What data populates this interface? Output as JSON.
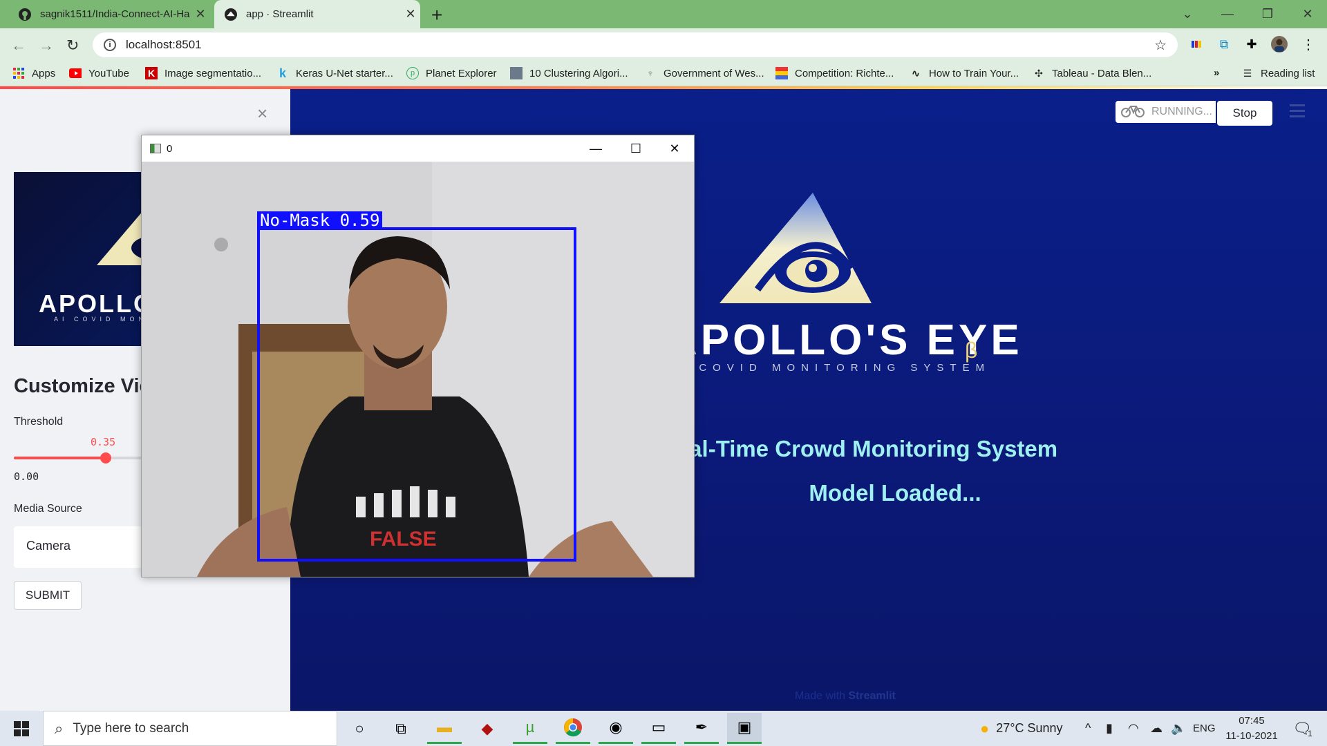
{
  "browser": {
    "tabs": [
      {
        "title": "sagnik1511/India-Connect-AI-Ha",
        "icon": "github-icon",
        "active": false
      },
      {
        "title": "app · Streamlit",
        "icon": "streamlit-icon",
        "active": true
      }
    ],
    "url": "localhost:8501",
    "bookmarks": [
      {
        "label": "Apps",
        "icon": "apps-grid-icon"
      },
      {
        "label": "YouTube",
        "icon": "youtube-icon"
      },
      {
        "label": "Image segmentatio...",
        "icon": "kaggle-k-icon"
      },
      {
        "label": "Keras U-Net starter...",
        "icon": "kaggle-k-icon"
      },
      {
        "label": "Planet Explorer",
        "icon": "planet-icon"
      },
      {
        "label": "10 Clustering Algori...",
        "icon": "page-icon"
      },
      {
        "label": "Government of Wes...",
        "icon": "emblem-icon"
      },
      {
        "label": "Competition: Richte...",
        "icon": "flag-icon"
      },
      {
        "label": "How to Train Your...",
        "icon": "wave-icon"
      },
      {
        "label": "Tableau - Data Blen...",
        "icon": "tableau-icon"
      }
    ],
    "bookmarks_overflow": "»",
    "reading_list": "Reading list"
  },
  "sidebar": {
    "close_glyph": "×",
    "logo_text": "APOLLO'S EYE",
    "logo_sub": "AI COVID MONITORING SYSTEM",
    "heading": "Customize View",
    "threshold": {
      "label": "Threshold",
      "value": "0.35",
      "min": "0.00",
      "fraction": 0.35
    },
    "media_source": {
      "label": "Media Source",
      "value": "Camera"
    },
    "submit_label": "SUBMIT"
  },
  "main": {
    "status_running": "RUNNING...",
    "stop_label": "Stop",
    "logo_text": "APOLLO'S EYE",
    "logo_beta": "β",
    "logo_sub": "AI COVID MONITORING SYSTEM",
    "heading": "Real-Time Crowd Monitoring System",
    "status": "Model Loaded...",
    "footer_prefix": "Made with",
    "footer_brand": "Streamlit"
  },
  "cv_window": {
    "title": "0",
    "detection_label": "No-Mask 0.59"
  },
  "taskbar": {
    "search_placeholder": "Type here to search",
    "weather": "27°C  Sunny",
    "lang": "ENG",
    "time": "07:45",
    "date": "11-10-2021",
    "notifications": "1"
  },
  "colors": {
    "accent": "#ff4b4b",
    "main_bg": "#0a1f8a",
    "heading_text": "#9ff0f0",
    "detection_box": "#1010ff",
    "chrome_theme": "#7ab873"
  }
}
